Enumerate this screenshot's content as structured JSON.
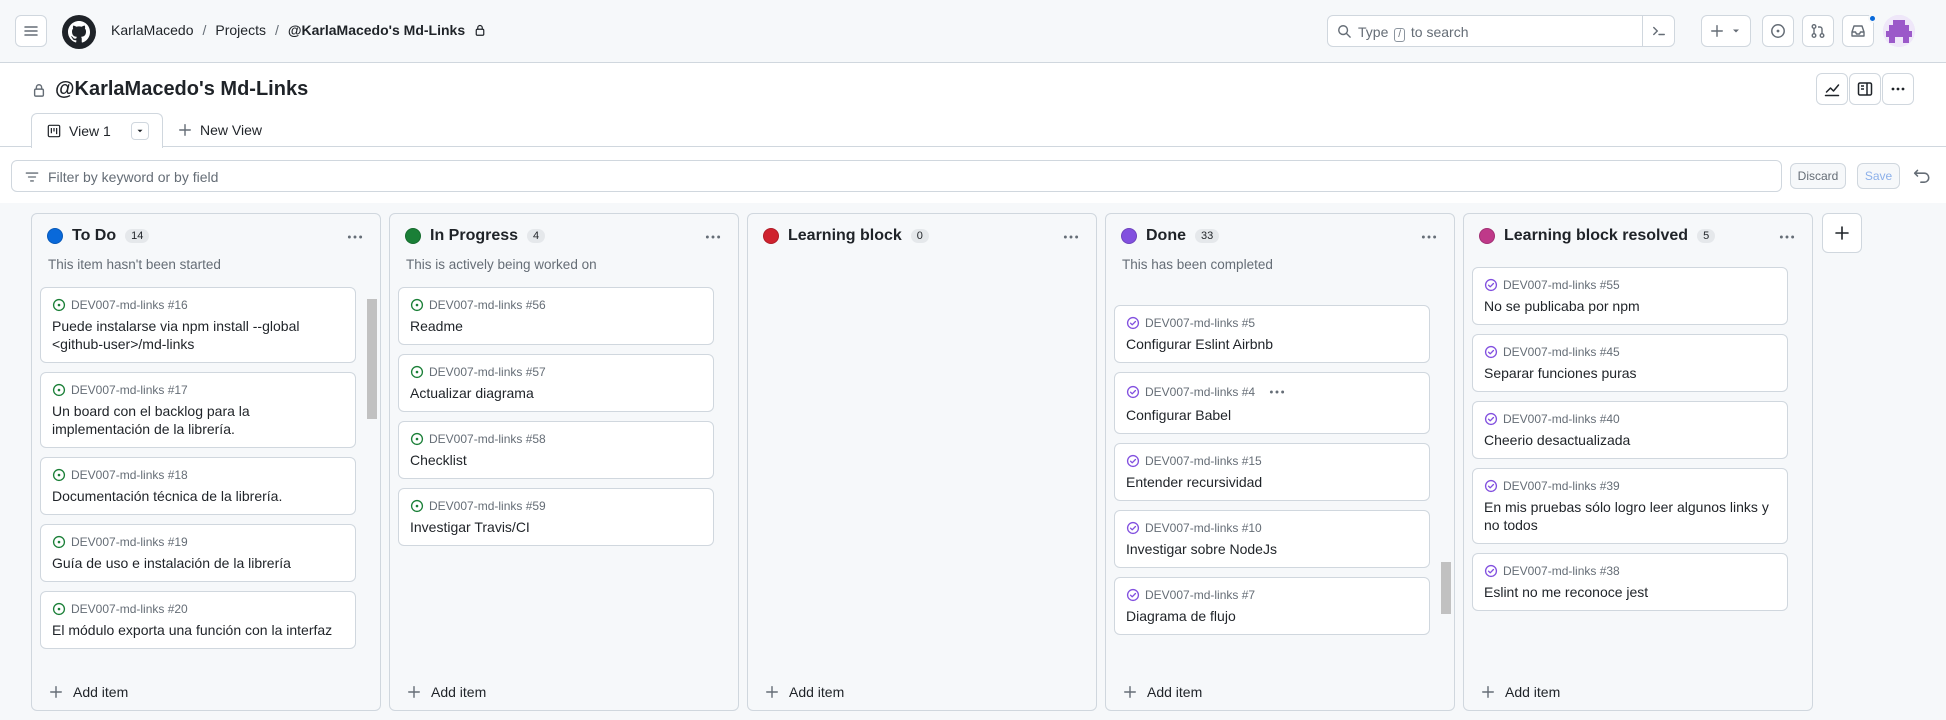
{
  "header": {
    "breadcrumbs": [
      "KarlaMacedo",
      "Projects",
      "@KarlaMacedo's Md-Links"
    ],
    "search_placeholder_pre": "Type",
    "search_key": "/",
    "search_placeholder_post": "to search"
  },
  "project": {
    "title": "@KarlaMacedo's Md-Links"
  },
  "views": {
    "active_tab": "View 1",
    "new_view": "New View"
  },
  "filter": {
    "placeholder": "Filter by keyword or by field",
    "discard": "Discard",
    "save": "Save"
  },
  "columns": [
    {
      "name": "To Do",
      "count": "14",
      "color": "#0969da",
      "description": "This item hasn't been started",
      "add_item": "Add item",
      "cards": [
        {
          "ref": "DEV007-md-links #16",
          "title": "Puede instalarse via npm install --global <github-user>/md-links",
          "status": "open"
        },
        {
          "ref": "DEV007-md-links #17",
          "title": "Un board con el backlog para la implementación de la librería.",
          "status": "open"
        },
        {
          "ref": "DEV007-md-links #18",
          "title": "Documentación técnica de la librería.",
          "status": "open"
        },
        {
          "ref": "DEV007-md-links #19",
          "title": "Guía de uso e instalación de la librería",
          "status": "open"
        },
        {
          "ref": "DEV007-md-links #20",
          "title": "El módulo exporta una función con la interfaz",
          "status": "open"
        }
      ]
    },
    {
      "name": "In Progress",
      "count": "4",
      "color": "#1a7f37",
      "description": "This is actively being worked on",
      "add_item": "Add item",
      "cards": [
        {
          "ref": "DEV007-md-links #56",
          "title": "Readme",
          "status": "open"
        },
        {
          "ref": "DEV007-md-links #57",
          "title": "Actualizar diagrama",
          "status": "open"
        },
        {
          "ref": "DEV007-md-links #58",
          "title": "Checklist",
          "status": "open"
        },
        {
          "ref": "DEV007-md-links #59",
          "title": "Investigar Travis/CI",
          "status": "open"
        }
      ]
    },
    {
      "name": "Learning block",
      "count": "0",
      "color": "#cf222e",
      "description": "",
      "add_item": "Add item",
      "cards": []
    },
    {
      "name": "Done",
      "count": "33",
      "color": "#8250df",
      "description": "This has been completed",
      "add_item": "Add item",
      "cards": [
        {
          "ref": "DEV007-md-links #5",
          "title": "Configurar Eslint Airbnb",
          "status": "closed"
        },
        {
          "ref": "DEV007-md-links #4",
          "title": "Configurar Babel",
          "status": "closed",
          "hovered": true
        },
        {
          "ref": "DEV007-md-links #15",
          "title": "Entender recursividad",
          "status": "closed"
        },
        {
          "ref": "DEV007-md-links #10",
          "title": "Investigar sobre NodeJs",
          "status": "closed"
        },
        {
          "ref": "DEV007-md-links #7",
          "title": "Diagrama de flujo",
          "status": "closed"
        }
      ]
    },
    {
      "name": "Learning block resolved",
      "count": "5",
      "color": "#bf3989",
      "description": "",
      "add_item": "Add item",
      "cards": [
        {
          "ref": "DEV007-md-links #55",
          "title": "No se publicaba por npm",
          "status": "closed"
        },
        {
          "ref": "DEV007-md-links #45",
          "title": "Separar funciones puras",
          "status": "closed"
        },
        {
          "ref": "DEV007-md-links #40",
          "title": "Cheerio desactualizada",
          "status": "closed"
        },
        {
          "ref": "DEV007-md-links #39",
          "title": "En mis pruebas sólo logro leer algunos links y no todos",
          "status": "closed"
        },
        {
          "ref": "DEV007-md-links #38",
          "title": "Eslint no me reconoce jest",
          "status": "closed"
        }
      ]
    }
  ]
}
